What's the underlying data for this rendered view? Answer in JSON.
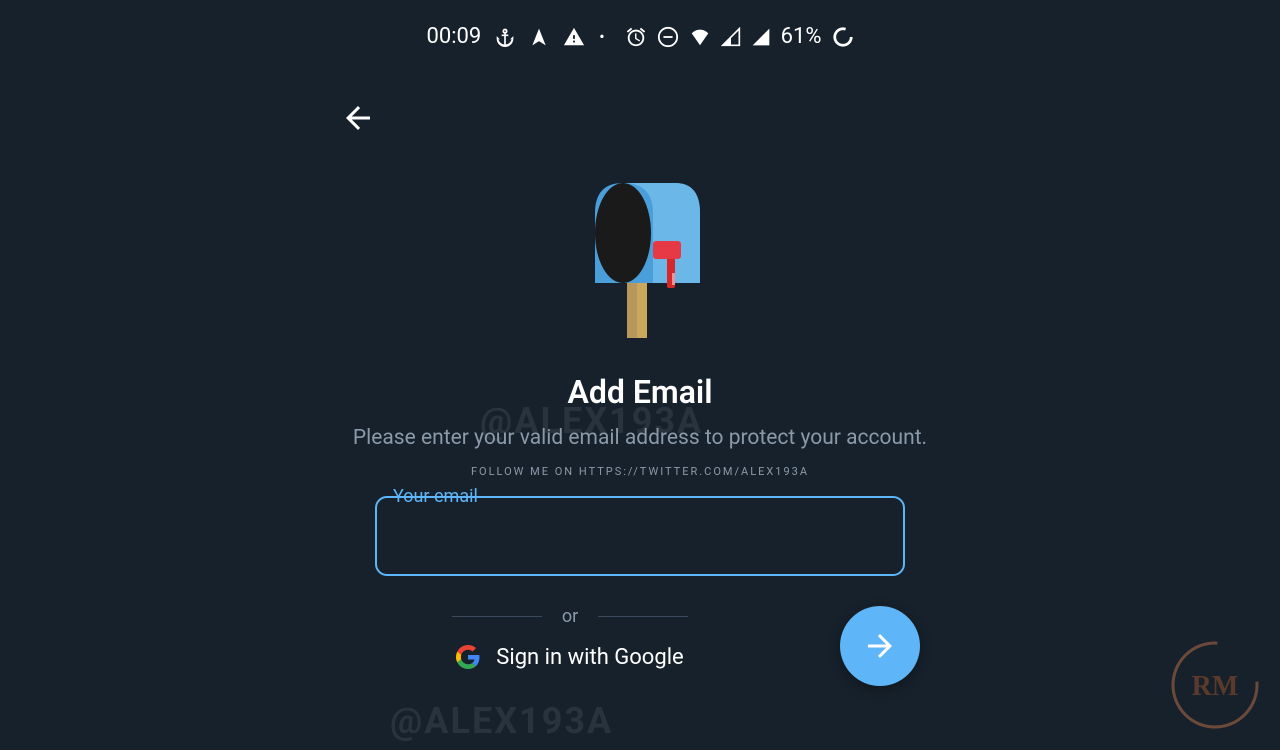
{
  "statusBar": {
    "time": "00:09",
    "battery": "61%"
  },
  "main": {
    "title": "Add Email",
    "subtitle": "Please enter your valid email address to protect your account.",
    "watermarkText": "FOLLOW ME ON HTTPS://TWITTER.COM/ALEX193A",
    "inputLabel": "Your email",
    "divider": "or",
    "googleButton": "Sign in with Google",
    "bgWatermark": "@ALEX193A"
  },
  "badge": {
    "text": "RM"
  }
}
